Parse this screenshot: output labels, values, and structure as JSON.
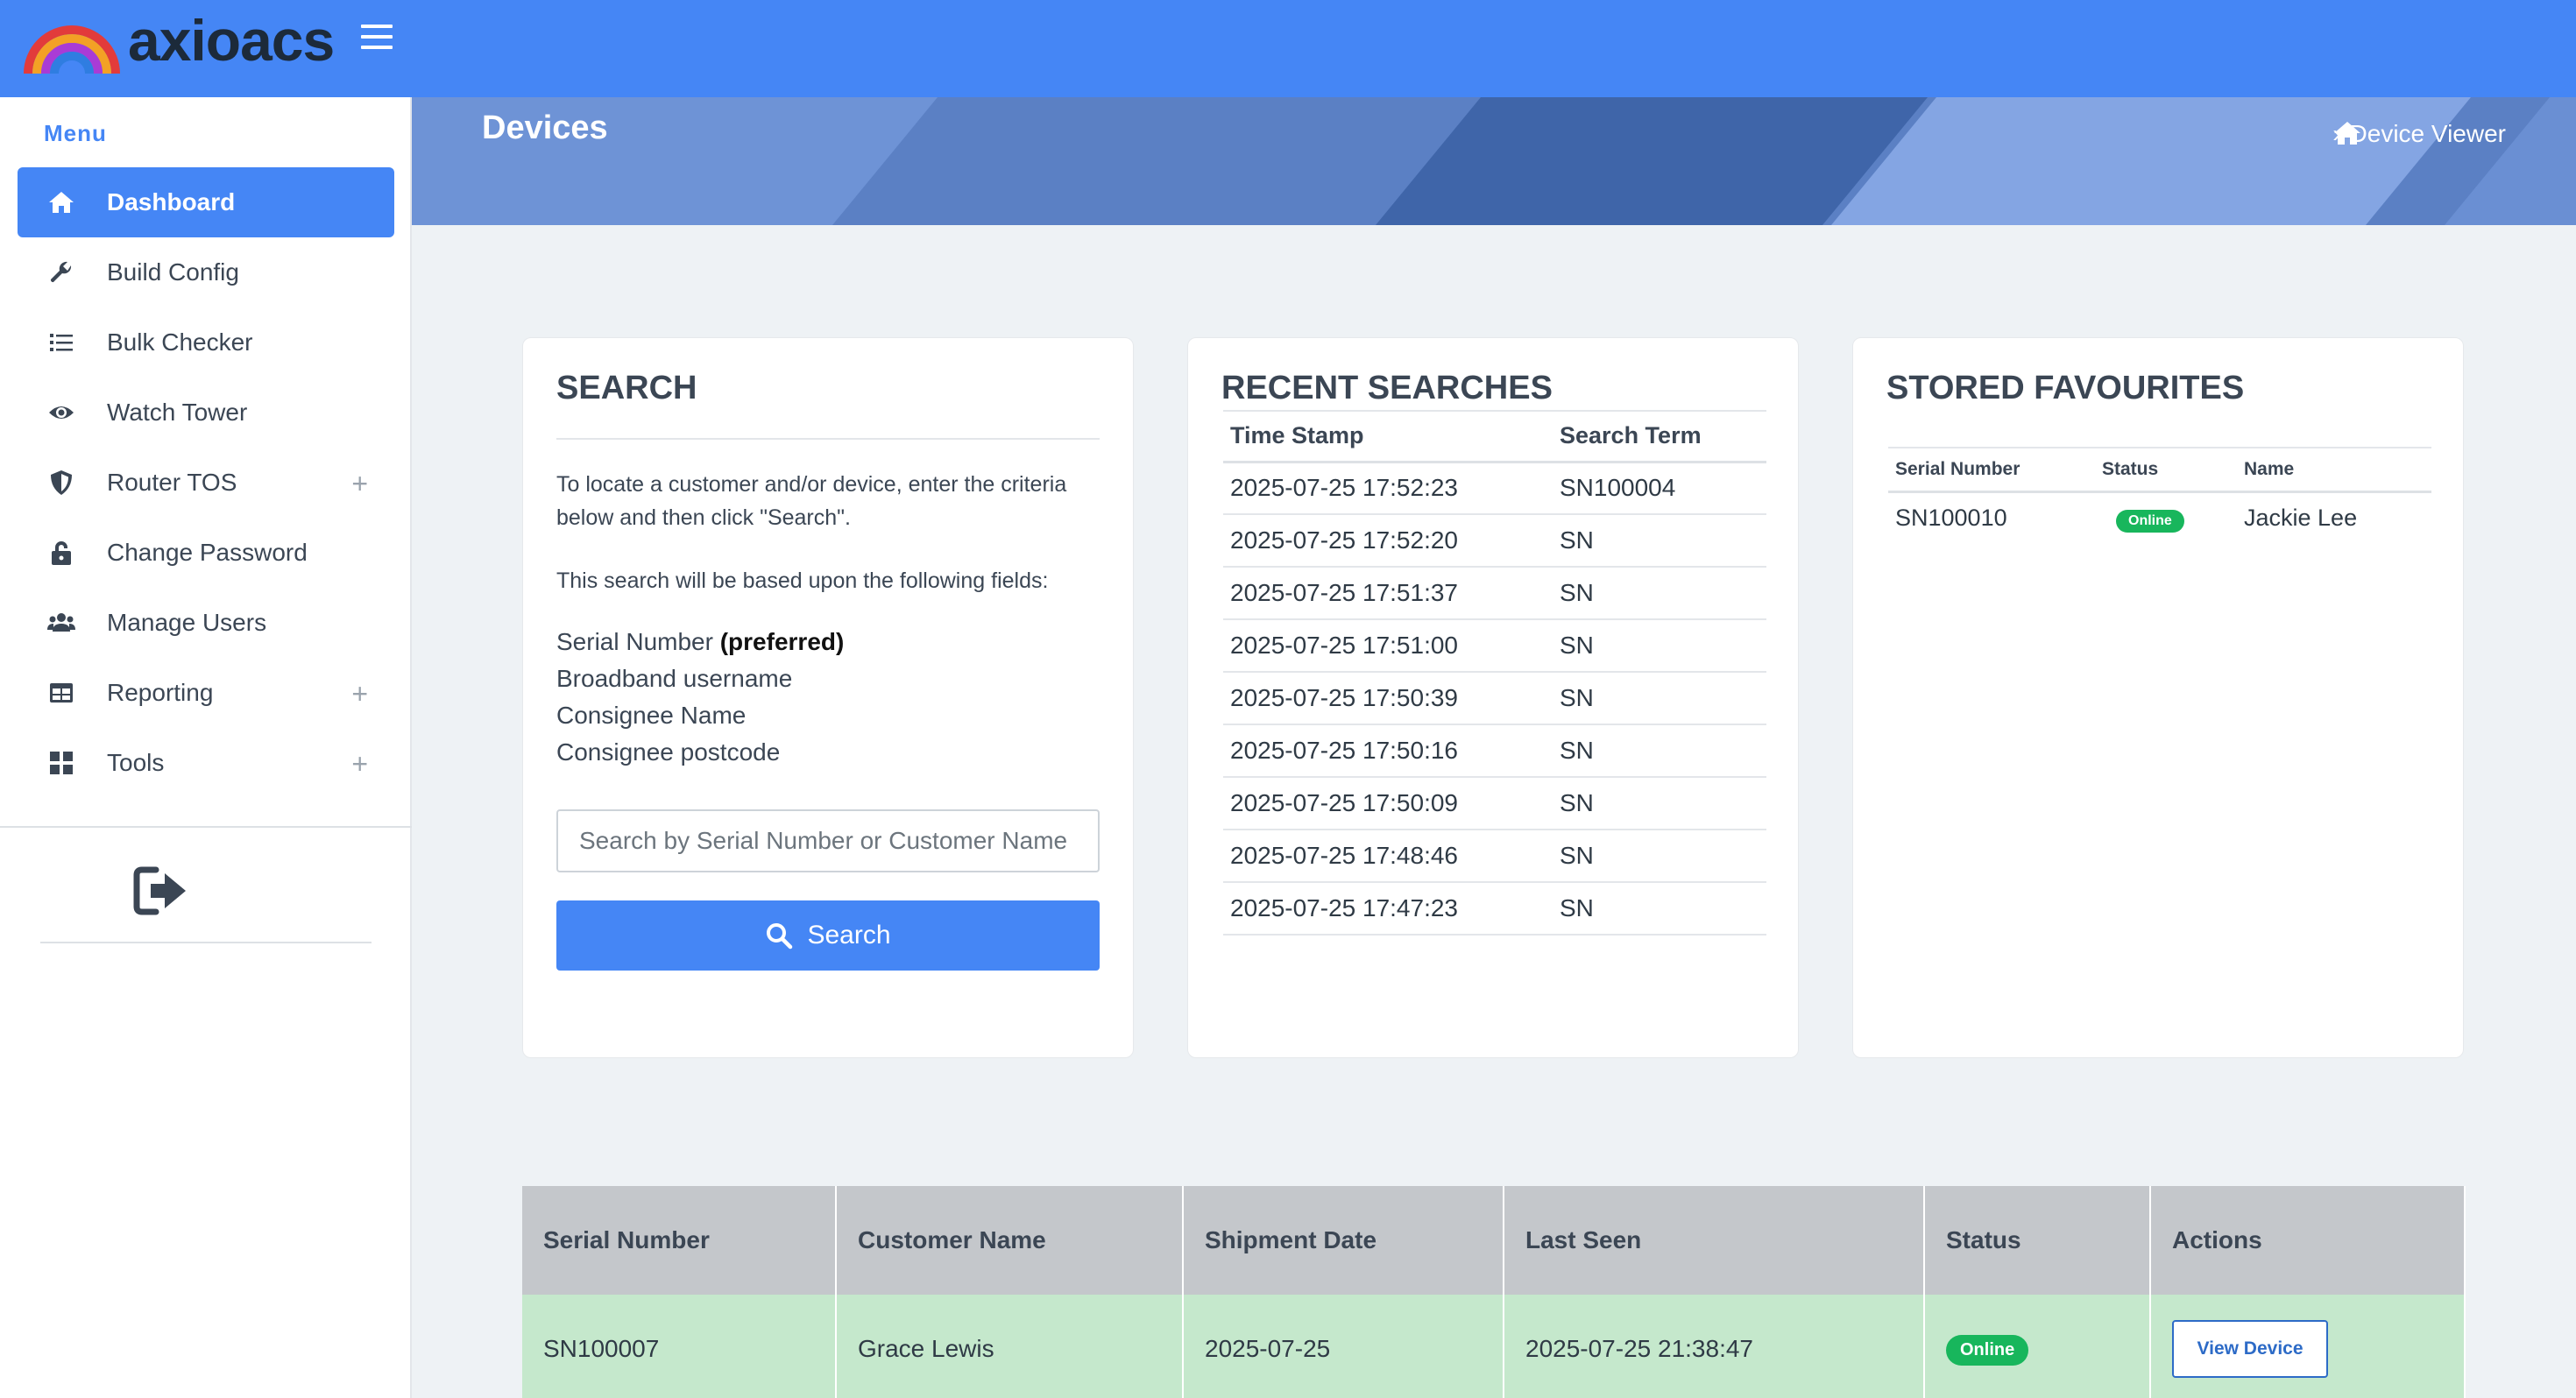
{
  "header": {
    "brand": "axioacs"
  },
  "sidebar": {
    "menu_label": "Menu",
    "items": [
      {
        "label": "Dashboard",
        "icon": "home-icon"
      },
      {
        "label": "Build Config",
        "icon": "wrench-icon"
      },
      {
        "label": "Bulk Checker",
        "icon": "list-icon"
      },
      {
        "label": "Watch Tower",
        "icon": "eye-icon"
      },
      {
        "label": "Router TOS",
        "icon": "shield-icon",
        "expandable": "+"
      },
      {
        "label": "Change Password",
        "icon": "lock-icon"
      },
      {
        "label": "Manage Users",
        "icon": "users-icon"
      },
      {
        "label": "Reporting",
        "icon": "table-icon",
        "expandable": "+"
      },
      {
        "label": "Tools",
        "icon": "grid-icon",
        "expandable": "+"
      }
    ]
  },
  "banner": {
    "title": "Devices",
    "breadcrumb": "Device Viewer"
  },
  "search": {
    "title": "SEARCH",
    "intro": "To locate a customer and/or device, enter the criteria below and then click \"Search\".",
    "fields_intro": "This search will be based upon the following fields:",
    "field_1": "Serial Number",
    "field_1_note": "(preferred)",
    "field_2": "Broadband username",
    "field_3": "Consignee Name",
    "field_4": "Consignee postcode",
    "placeholder": "Search by Serial Number or Customer Name",
    "button_label": "Search"
  },
  "recent": {
    "title": "RECENT SEARCHES",
    "columns": [
      "Time Stamp",
      "Search Term"
    ],
    "rows": [
      [
        "2025-07-25 17:52:23",
        "SN100004"
      ],
      [
        "2025-07-25 17:52:20",
        "SN"
      ],
      [
        "2025-07-25 17:51:37",
        "SN"
      ],
      [
        "2025-07-25 17:51:00",
        "SN"
      ],
      [
        "2025-07-25 17:50:39",
        "SN"
      ],
      [
        "2025-07-25 17:50:16",
        "SN"
      ],
      [
        "2025-07-25 17:50:09",
        "SN"
      ],
      [
        "2025-07-25 17:48:46",
        "SN"
      ],
      [
        "2025-07-25 17:47:23",
        "SN"
      ]
    ]
  },
  "favourites": {
    "title": "STORED FAVOURITES",
    "columns": [
      "Serial Number",
      "Status",
      "Name"
    ],
    "rows": [
      {
        "serial": "SN100010",
        "status": "Online",
        "name": "Jackie Lee"
      }
    ]
  },
  "devices": {
    "columns": [
      "Serial Number",
      "Customer Name",
      "Shipment Date",
      "Last Seen",
      "Status",
      "Actions"
    ],
    "rows": [
      {
        "serial": "SN100007",
        "customer": "Grace Lewis",
        "shipment": "2025-07-25",
        "last_seen": "2025-07-25 21:38:47",
        "status": "Online",
        "action": "View Device"
      }
    ]
  },
  "colors": {
    "primary": "#4586f5",
    "online": "#18b65c",
    "row_highlight": "#c5e8cc"
  }
}
